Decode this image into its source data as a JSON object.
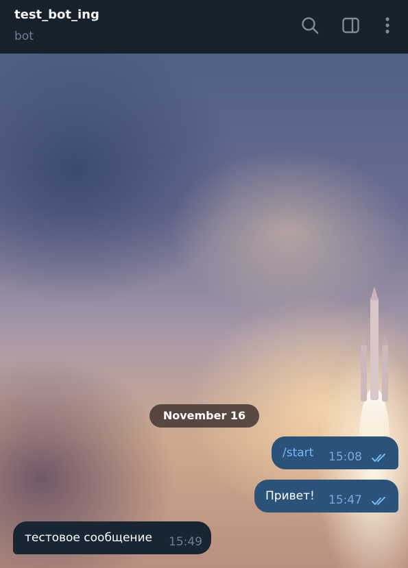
{
  "header": {
    "title": "test_bot_ing",
    "subtitle": "bot",
    "icons": [
      "search-icon",
      "sidebar-toggle-icon",
      "more-options-icon"
    ]
  },
  "chat": {
    "date_label": "November 16",
    "messages": [
      {
        "direction": "outgoing",
        "text": "/start",
        "time": "15:08",
        "status": "read"
      },
      {
        "direction": "outgoing",
        "text": "Привет!",
        "time": "15:47",
        "status": "read"
      },
      {
        "direction": "incoming",
        "text": "тестовое сообщение",
        "time": "15:49"
      }
    ]
  },
  "colors": {
    "header_bg": "#17212b",
    "outgoing_bubble": "#2b5278",
    "incoming_bubble": "#182533",
    "link": "#71baf5",
    "date_pill": "#463a34"
  }
}
